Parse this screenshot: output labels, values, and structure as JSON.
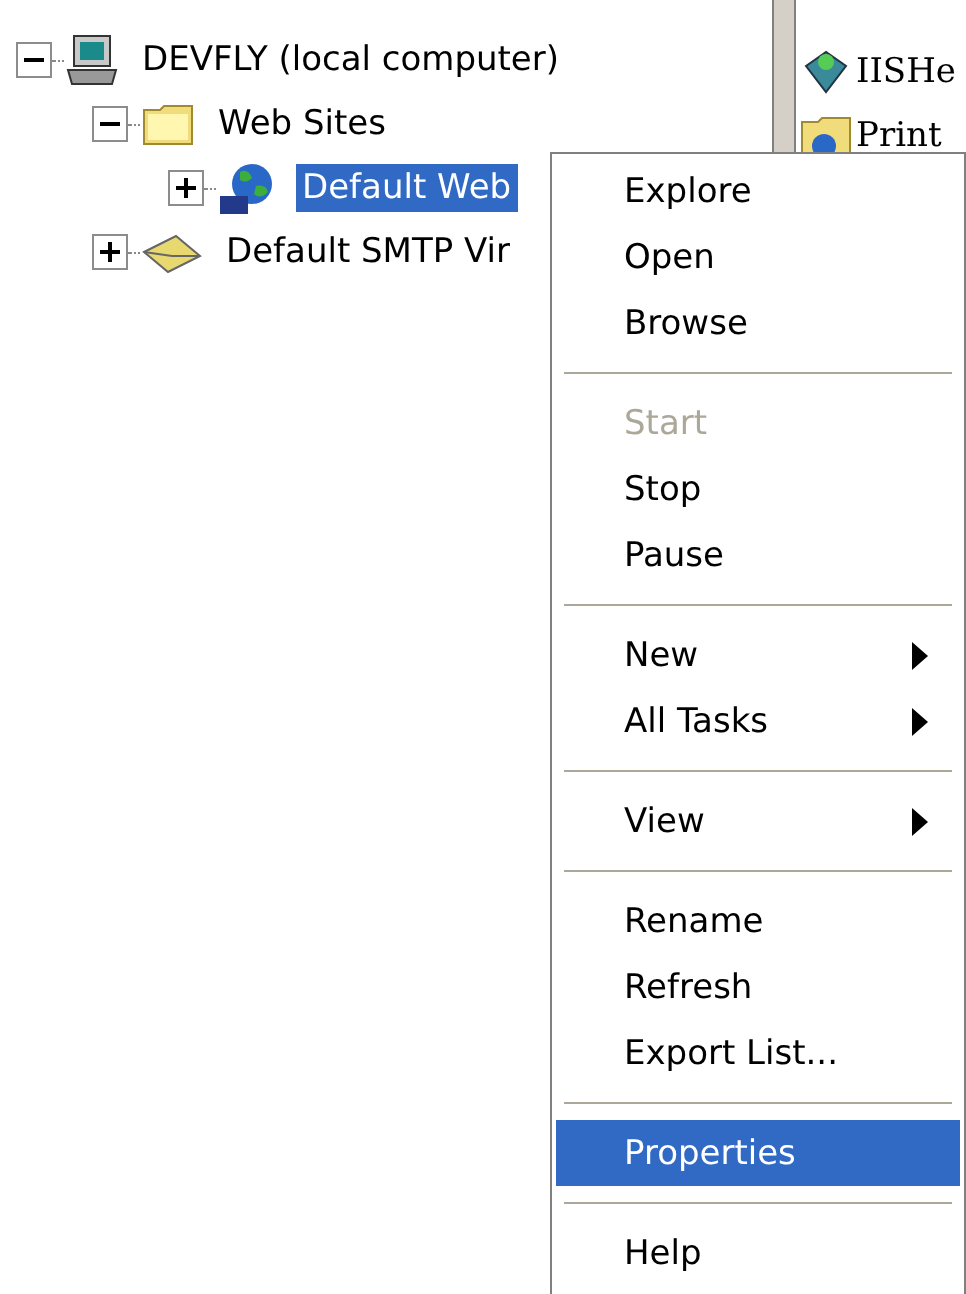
{
  "tree": [
    {
      "label": "DEVFLY (local computer)",
      "kind": "computer",
      "expanded": true,
      "selected": false,
      "children": [
        {
          "label": "Web Sites",
          "kind": "folder",
          "expanded": true,
          "selected": false,
          "children": [
            {
              "label": "Default Web",
              "kind": "site",
              "expanded": false,
              "selected": true
            }
          ]
        },
        {
          "label": "Default SMTP Vir",
          "kind": "smtp",
          "expanded": false,
          "selected": false
        }
      ]
    }
  ],
  "list": [
    {
      "label": "IISHe",
      "kind": "package"
    },
    {
      "label": "Print",
      "kind": "folder"
    }
  ],
  "context_menu": [
    {
      "kind": "item",
      "label": "Explore",
      "disabled": false,
      "selected": false,
      "submenu": false
    },
    {
      "kind": "item",
      "label": "Open",
      "disabled": false,
      "selected": false,
      "submenu": false
    },
    {
      "kind": "item",
      "label": "Browse",
      "disabled": false,
      "selected": false,
      "submenu": false
    },
    {
      "kind": "separator"
    },
    {
      "kind": "item",
      "label": "Start",
      "disabled": true,
      "selected": false,
      "submenu": false
    },
    {
      "kind": "item",
      "label": "Stop",
      "disabled": false,
      "selected": false,
      "submenu": false
    },
    {
      "kind": "item",
      "label": "Pause",
      "disabled": false,
      "selected": false,
      "submenu": false
    },
    {
      "kind": "separator"
    },
    {
      "kind": "item",
      "label": "New",
      "disabled": false,
      "selected": false,
      "submenu": true
    },
    {
      "kind": "item",
      "label": "All Tasks",
      "disabled": false,
      "selected": false,
      "submenu": true
    },
    {
      "kind": "separator"
    },
    {
      "kind": "item",
      "label": "View",
      "disabled": false,
      "selected": false,
      "submenu": true
    },
    {
      "kind": "separator"
    },
    {
      "kind": "item",
      "label": "Rename",
      "disabled": false,
      "selected": false,
      "submenu": false
    },
    {
      "kind": "item",
      "label": "Refresh",
      "disabled": false,
      "selected": false,
      "submenu": false
    },
    {
      "kind": "item",
      "label": "Export List...",
      "disabled": false,
      "selected": false,
      "submenu": false
    },
    {
      "kind": "separator"
    },
    {
      "kind": "item",
      "label": "Properties",
      "disabled": false,
      "selected": true,
      "submenu": false
    },
    {
      "kind": "separator"
    },
    {
      "kind": "item",
      "label": "Help",
      "disabled": false,
      "selected": false,
      "submenu": false
    }
  ]
}
